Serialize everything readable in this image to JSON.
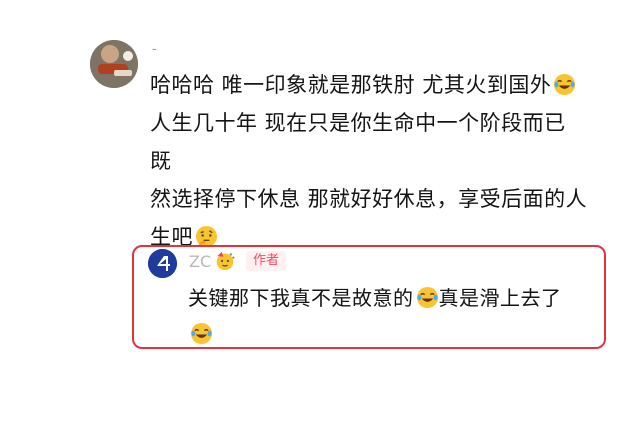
{
  "comment": {
    "username": "-",
    "lines": [
      "哈哈哈 唯一印象就是那铁肘 尤其火到国外",
      "人生几十年 现在只是你生命中一个阶段而已 既",
      "然选择停下休息 那就好好休息，享受后面的人",
      "生吧"
    ],
    "emoji_1": "laughing-crying-emoji",
    "emoji_2": "thinking-face-emoji"
  },
  "reply": {
    "username": "ZC",
    "badge": "作者",
    "line_1": "关键那下我真不是故意的",
    "line_1_end": "真是滑上去了",
    "emoji_user": "partying-face-emoji",
    "emoji_inline": "rofl-emoji"
  },
  "colors": {
    "highlight_border": "#e3333d",
    "badge_text": "#ef4e66",
    "badge_bg": "#fff0f2",
    "reply_avatar": "#1f3b9c"
  }
}
